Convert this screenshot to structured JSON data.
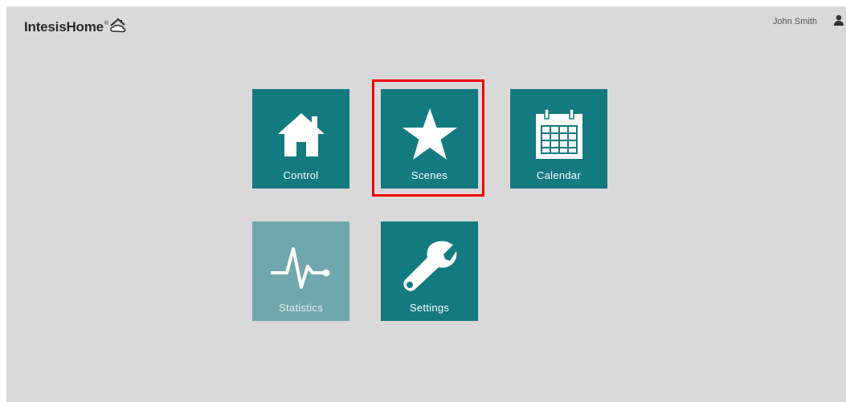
{
  "header": {
    "logo_text": "IntesisHome",
    "logo_reg": "®",
    "user_name": "John Smith",
    "logo_icon": "house-cloud-icon",
    "user_icon": "user-icon"
  },
  "tiles": [
    {
      "label": "Control",
      "icon": "home-icon",
      "enabled": true
    },
    {
      "label": "Scenes",
      "icon": "star-icon",
      "enabled": true,
      "highlighted": true
    },
    {
      "label": "Calendar",
      "icon": "calendar-icon",
      "enabled": true
    },
    {
      "label": "Statistics",
      "icon": "heartbeat-icon",
      "enabled": false
    },
    {
      "label": "Settings",
      "icon": "wrench-icon",
      "enabled": true
    }
  ],
  "colors": {
    "background": "#d9d9d9",
    "tile": "#137a80",
    "tile_disabled": "#6fa7ad",
    "highlight": "#ee0000"
  }
}
